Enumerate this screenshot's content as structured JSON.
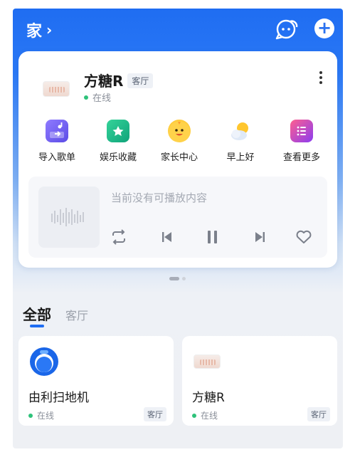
{
  "header": {
    "home_label": "家",
    "chevron": "›"
  },
  "device": {
    "name": "方糖R",
    "room": "客厅",
    "status": "在线",
    "status_color": "#2ec27a"
  },
  "shortcuts": [
    {
      "label": "导入歌单",
      "icon": "import-playlist-icon"
    },
    {
      "label": "娱乐收藏",
      "icon": "favorites-folder-icon"
    },
    {
      "label": "家长中心",
      "icon": "parent-center-icon"
    },
    {
      "label": "早上好",
      "icon": "good-morning-icon"
    },
    {
      "label": "查看更多",
      "icon": "more-apps-icon"
    }
  ],
  "player": {
    "message": "当前没有可播放内容"
  },
  "tabs": {
    "all": "全部",
    "room": "客厅"
  },
  "devices": [
    {
      "name": "由利扫地机",
      "status": "在线",
      "room": "客厅",
      "icon": "robot-vacuum-icon"
    },
    {
      "name": "方糖R",
      "status": "在线",
      "room": "客厅",
      "icon": "speaker-icon"
    }
  ],
  "colors": {
    "accent": "#1f6df2",
    "online": "#2ec27a"
  }
}
